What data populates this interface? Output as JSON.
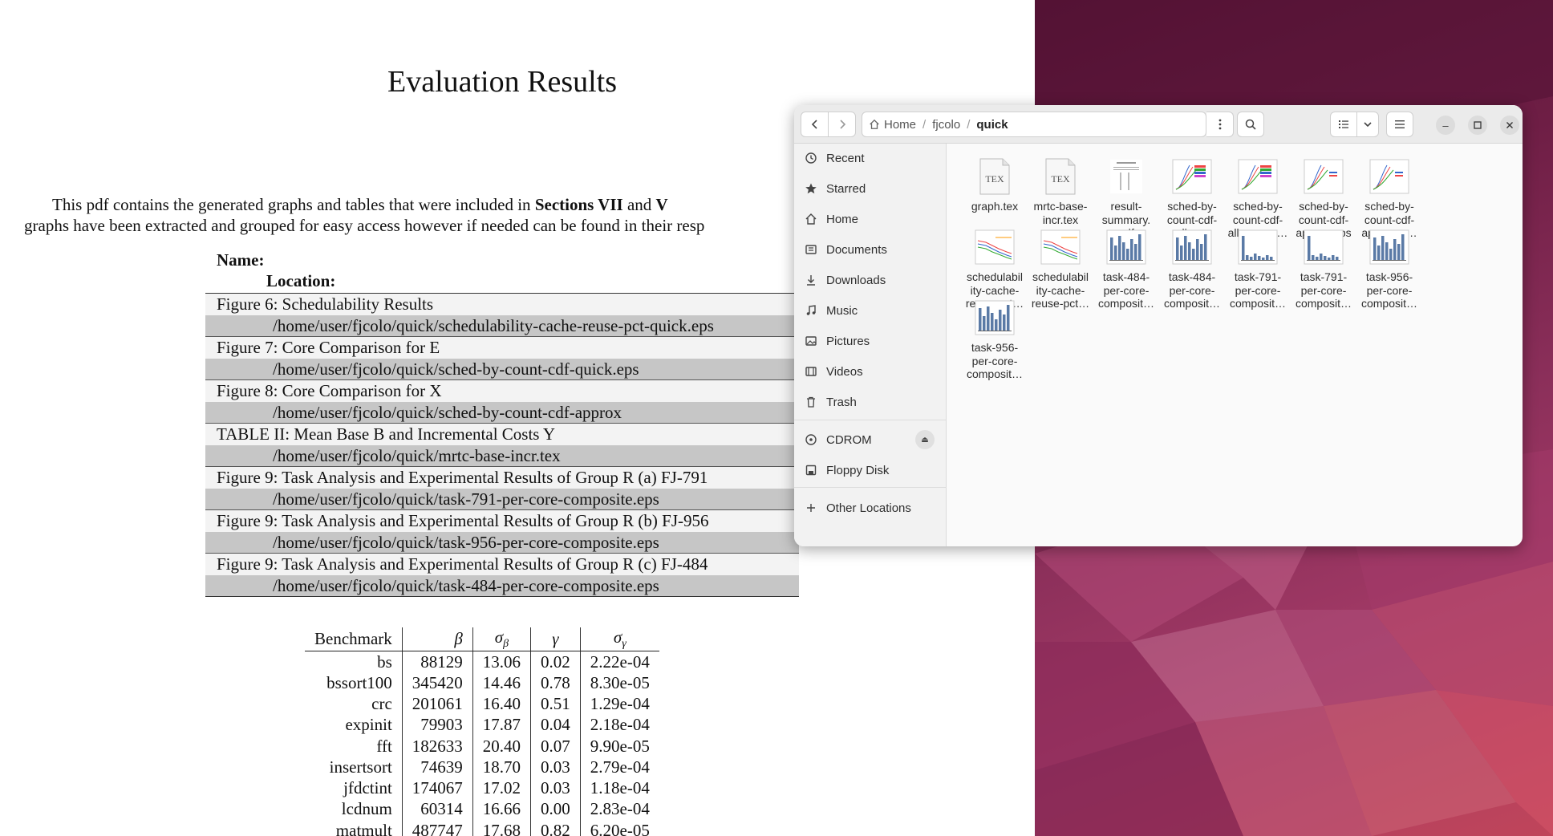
{
  "pdf": {
    "title": "Evaluation Results",
    "intro_line1_a": "This pdf contains the generated graphs and tables that were included in ",
    "intro_line1_b": "Sections VII",
    "intro_line1_c": " and ",
    "intro_line1_d": "V",
    "intro_line2": "graphs have been extracted and grouped for easy access however if needed can be found in their resp",
    "name_label": "Name:",
    "location_label": "Location:",
    "figures": [
      {
        "title": "Figure 6: Schedulability Results",
        "path": "/home/user/fjcolo/quick/schedulability-cache-reuse-pct-quick.eps"
      },
      {
        "title": "Figure 7: Core Comparison for E",
        "path": "/home/user/fjcolo/quick/sched-by-count-cdf-quick.eps"
      },
      {
        "title": "Figure 8: Core Comparison for X",
        "path": "/home/user/fjcolo/quick/sched-by-count-cdf-approx"
      },
      {
        "title": "TABLE II: Mean Base B and Incremental Costs Y",
        "path": "/home/user/fjcolo/quick/mrtc-base-incr.tex"
      },
      {
        "title": "Figure 9: Task Analysis and Experimental Results of Group R (a) FJ-791",
        "path": "/home/user/fjcolo/quick/task-791-per-core-composite.eps"
      },
      {
        "title": "Figure 9: Task Analysis and Experimental Results of Group R (b) FJ-956",
        "path": "/home/user/fjcolo/quick/task-956-per-core-composite.eps"
      },
      {
        "title": "Figure 9: Task Analysis and Experimental Results of Group R (c) FJ-484",
        "path": "/home/user/fjcolo/quick/task-484-per-core-composite.eps"
      }
    ],
    "table": {
      "headers": [
        "Benchmark",
        "β",
        "σ",
        "γ",
        "σ"
      ],
      "header_subs": [
        "",
        "",
        "β",
        "",
        "γ"
      ],
      "rows": [
        [
          "bs",
          "88129",
          "13.06",
          "0.02",
          "2.22e-04"
        ],
        [
          "bssort100",
          "345420",
          "14.46",
          "0.78",
          "8.30e-05"
        ],
        [
          "crc",
          "201061",
          "16.40",
          "0.51",
          "1.29e-04"
        ],
        [
          "expinit",
          "79903",
          "17.87",
          "0.04",
          "2.18e-04"
        ],
        [
          "fft",
          "182633",
          "20.40",
          "0.07",
          "9.90e-05"
        ],
        [
          "insertsort",
          "74639",
          "18.70",
          "0.03",
          "2.79e-04"
        ],
        [
          "jfdctint",
          "174067",
          "17.02",
          "0.03",
          "1.18e-04"
        ],
        [
          "lcdnum",
          "60314",
          "16.66",
          "0.00",
          "2.83e-04"
        ],
        [
          "matmult",
          "487747",
          "17.68",
          "0.82",
          "6.20e-05"
        ]
      ]
    }
  },
  "files": {
    "path": [
      "Home",
      "fjcolo",
      "quick"
    ],
    "sidebar": [
      {
        "label": "Recent",
        "icon": "clock-icon"
      },
      {
        "label": "Starred",
        "icon": "star-icon"
      },
      {
        "label": "Home",
        "icon": "home-icon"
      },
      {
        "label": "Documents",
        "icon": "document-icon"
      },
      {
        "label": "Downloads",
        "icon": "download-icon"
      },
      {
        "label": "Music",
        "icon": "music-icon"
      },
      {
        "label": "Pictures",
        "icon": "picture-icon"
      },
      {
        "label": "Videos",
        "icon": "video-icon"
      },
      {
        "label": "Trash",
        "icon": "trash-icon"
      },
      {
        "label": "CDROM",
        "icon": "disc-icon"
      },
      {
        "label": "Floppy Disk",
        "icon": "drive-icon"
      },
      {
        "label": "Other Locations",
        "icon": "plus-icon"
      }
    ],
    "items": [
      {
        "name": "graph.tex",
        "kind": "tex"
      },
      {
        "name": "mrtc-base-\nincr.tex",
        "kind": "tex"
      },
      {
        "name": "result-\nsummary.\npdf",
        "kind": "pdf"
      },
      {
        "name": "sched-by-\ncount-cdf-\nall.eps",
        "kind": "cdf"
      },
      {
        "name": "sched-by-\ncount-cdf-\nall-eps-co…",
        "kind": "cdf"
      },
      {
        "name": "sched-by-\ncount-cdf-\napprox.eps",
        "kind": "cdf2"
      },
      {
        "name": "sched-by-\ncount-cdf-\napprox-e…",
        "kind": "cdf2"
      },
      {
        "name": "schedulabil\nity-cache-\nreuse-pct…",
        "kind": "sched"
      },
      {
        "name": "schedulabil\nity-cache-\nreuse-pct…",
        "kind": "sched"
      },
      {
        "name": "task-484-\nper-core-\ncomposit…",
        "kind": "bars"
      },
      {
        "name": "task-484-\nper-core-\ncomposit…",
        "kind": "bars"
      },
      {
        "name": "task-791-\nper-core-\ncomposit…",
        "kind": "bars2"
      },
      {
        "name": "task-791-\nper-core-\ncomposit…",
        "kind": "bars2"
      },
      {
        "name": "task-956-\nper-core-\ncomposit…",
        "kind": "bars"
      },
      {
        "name": "task-956-\nper-core-\ncomposit…",
        "kind": "bars"
      }
    ]
  },
  "colors": {
    "desktop_dark": "#5a1538",
    "desktop_light": "#c0455a",
    "table_band": "#c6c6c6"
  }
}
